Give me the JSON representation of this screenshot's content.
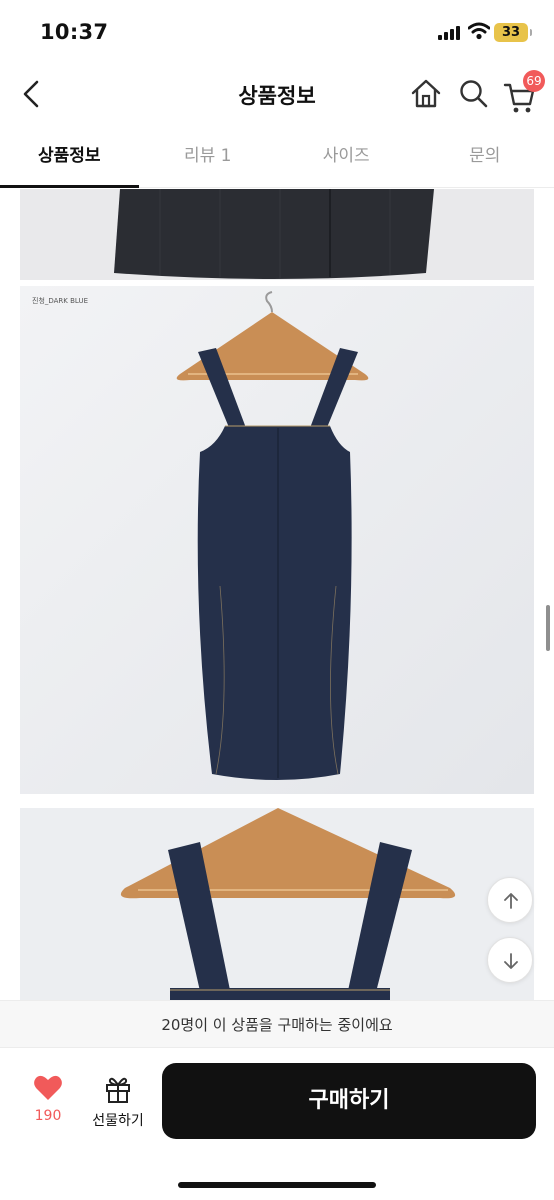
{
  "status_bar": {
    "time": "10:37",
    "battery": "33"
  },
  "header": {
    "title": "상품정보",
    "cart_count": "69"
  },
  "tabs": [
    {
      "label": "상품정보",
      "active": true
    },
    {
      "label": "리뷰 1",
      "active": false
    },
    {
      "label": "사이즈",
      "active": false
    },
    {
      "label": "문의",
      "active": false
    }
  ],
  "content": {
    "photo_caption": "진청_DARK BLUE"
  },
  "notice": {
    "text": "20명이 이 상품을 구매하는 중이에요"
  },
  "actions": {
    "like_count": "190",
    "gift_label": "선물하기",
    "buy_label": "구매하기"
  },
  "colors": {
    "accent": "#f15a5a",
    "denim": "#25304a",
    "buy_button": "#111111"
  }
}
